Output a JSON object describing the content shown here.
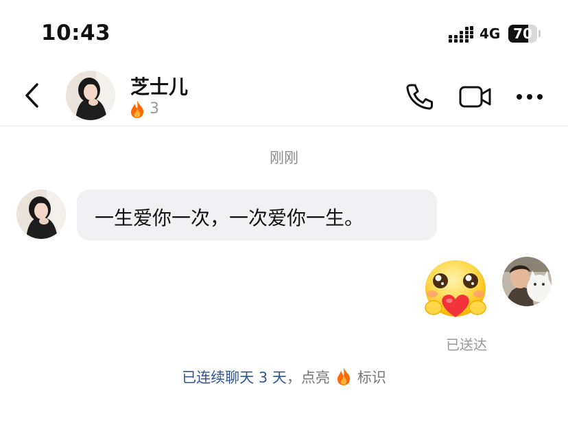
{
  "status_bar": {
    "time": "10:43",
    "network": "4G",
    "battery": "70",
    "battery_level": 0.7,
    "signal_icon": "signal-bars-icon"
  },
  "header": {
    "contact_name": "芝士儿",
    "streak_count": "3",
    "icons": [
      "back-chevron-icon",
      "phone-icon",
      "video-camera-icon",
      "more-dots-icon"
    ]
  },
  "chat": {
    "timestamp": "刚刚",
    "incoming_message": "一生爱你一次，一次爱你一生。",
    "outgoing_sticker": "heart-hug-emoji-sticker",
    "delivery_status": "已送达"
  },
  "streak_note": {
    "part1": "已连续聊天 3 天",
    "part2": "，点亮",
    "part3": "标识"
  },
  "colors": {
    "accent_blue": "#2f5597",
    "bubble_bg": "#f1f1f3",
    "flame": "#ff6a00"
  }
}
